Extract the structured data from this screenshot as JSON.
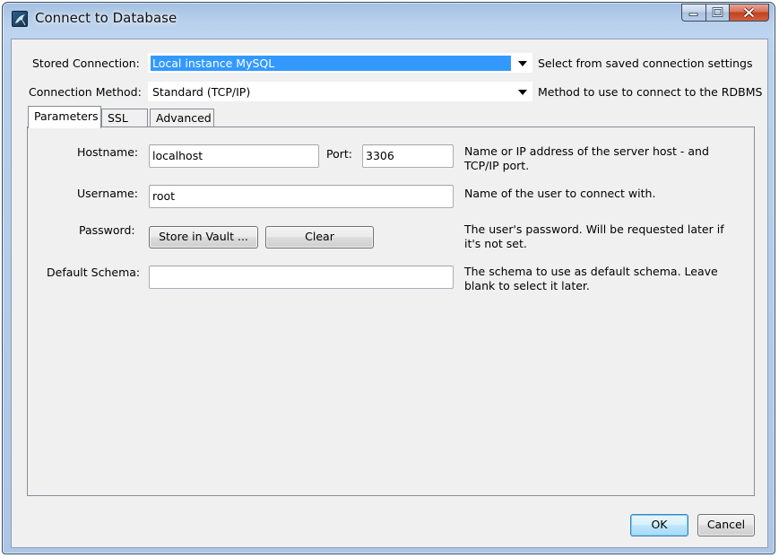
{
  "window": {
    "title": "Connect to Database",
    "colors": {
      "frame": "#b9d1ec",
      "selection": "#3399ff",
      "close": "#c2401f"
    }
  },
  "stored_connection": {
    "label": "Stored Connection:",
    "value": "Local instance MySQL",
    "description": "Select from saved connection settings"
  },
  "connection_method": {
    "label": "Connection Method:",
    "value": "Standard (TCP/IP)",
    "description": "Method to use to connect to the RDBMS"
  },
  "tabs": [
    {
      "label": "Parameters",
      "active": true
    },
    {
      "label": "SSL",
      "active": false
    },
    {
      "label": "Advanced",
      "active": false
    }
  ],
  "parameters": {
    "hostname": {
      "label": "Hostname:",
      "value": "localhost",
      "port_label": "Port:",
      "port_value": "3306",
      "description": "Name or IP address of the server host - and TCP/IP port."
    },
    "username": {
      "label": "Username:",
      "value": "root",
      "description": "Name of the user to connect with."
    },
    "password": {
      "label": "Password:",
      "store_button": "Store in Vault ...",
      "clear_button": "Clear",
      "description": "The user's password. Will be requested later if it's not set."
    },
    "default_schema": {
      "label": "Default Schema:",
      "value": "",
      "description": "The schema to use as default schema. Leave blank to select it later."
    }
  },
  "buttons": {
    "ok": "OK",
    "cancel": "Cancel"
  },
  "icons": {
    "app": "mysql-workbench-dolphin-icon",
    "minimize": "minimize-icon",
    "maximize": "maximize-icon",
    "close": "close-icon",
    "dropdown": "chevron-down-icon"
  }
}
